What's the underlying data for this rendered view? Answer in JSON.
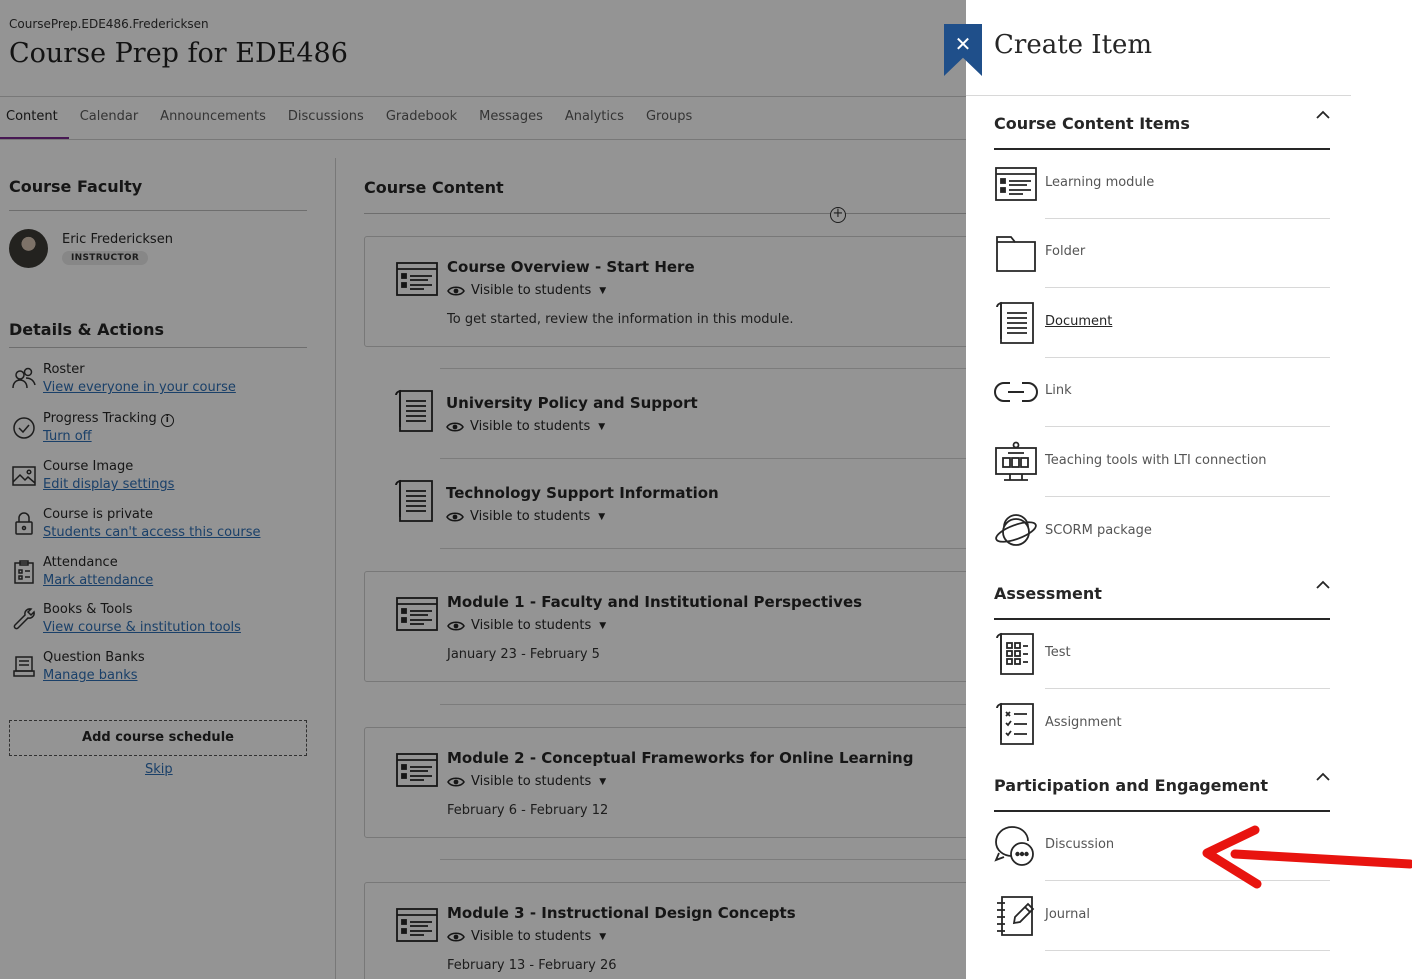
{
  "course": {
    "id": "CoursePrep.EDE486.Fredericksen",
    "title": "Course Prep for EDE486",
    "tabs": [
      "Content",
      "Calendar",
      "Announcements",
      "Discussions",
      "Gradebook",
      "Messages",
      "Analytics",
      "Groups"
    ],
    "active_tab": "Content"
  },
  "faculty": {
    "heading": "Course Faculty",
    "name": "Eric Fredericksen",
    "role": "INSTRUCTOR"
  },
  "details": {
    "heading": "Details & Actions",
    "items": [
      {
        "title": "Roster",
        "link": "View everyone in your course",
        "icon": "roster-icon"
      },
      {
        "title": "Progress Tracking",
        "link": "Turn off",
        "icon": "progress-icon"
      },
      {
        "title": "Course Image",
        "link": "Edit display settings",
        "icon": "image-icon"
      },
      {
        "title": "Course is private",
        "link": "Students can't access this course",
        "icon": "lock-icon"
      },
      {
        "title": "Attendance",
        "link": "Mark attendance",
        "icon": "attendance-icon"
      },
      {
        "title": "Books & Tools",
        "link": "View course & institution tools",
        "icon": "wrench-icon"
      },
      {
        "title": "Question Banks",
        "link": "Manage banks",
        "icon": "question-bank-icon"
      }
    ],
    "schedule_button": "Add course schedule",
    "skip_link": "Skip"
  },
  "content": {
    "heading": "Course Content",
    "visibility_label": "Visible to students",
    "items": [
      {
        "title": "Course Overview - Start Here",
        "desc": "To get started, review the information in this module.",
        "type": "module"
      },
      {
        "title": "University Policy and Support",
        "desc": "",
        "type": "document"
      },
      {
        "title": "Technology Support Information",
        "desc": "",
        "type": "document"
      },
      {
        "title": "Module 1 - Faculty and Institutional Perspectives",
        "desc": "January 23 - February 5",
        "type": "module"
      },
      {
        "title": "Module 2 - Conceptual Frameworks for Online Learning",
        "desc": "February 6 - February 12",
        "type": "module"
      },
      {
        "title": "Module 3 - Instructional Design Concepts",
        "desc": "February 13 - February 26",
        "type": "module"
      }
    ]
  },
  "panel": {
    "title": "Create Item",
    "close_icon": "close-icon",
    "groups": [
      {
        "heading": "Course Content Items",
        "items": [
          {
            "label": "Learning module",
            "icon": "learning-module-icon"
          },
          {
            "label": "Folder",
            "icon": "folder-icon"
          },
          {
            "label": "Document",
            "icon": "document-icon"
          },
          {
            "label": "Link",
            "icon": "link-icon"
          },
          {
            "label": "Teaching tools with LTI connection",
            "icon": "lti-tools-icon"
          },
          {
            "label": "SCORM package",
            "icon": "scorm-icon"
          }
        ]
      },
      {
        "heading": "Assessment",
        "items": [
          {
            "label": "Test",
            "icon": "test-icon"
          },
          {
            "label": "Assignment",
            "icon": "assignment-icon"
          }
        ]
      },
      {
        "heading": "Participation and Engagement",
        "items": [
          {
            "label": "Discussion",
            "icon": "discussion-icon"
          },
          {
            "label": "Journal",
            "icon": "journal-icon"
          }
        ]
      }
    ]
  },
  "colors": {
    "accent_tab": "#7b2a8f",
    "link": "#2e6fb5",
    "close_button": "#1f4f8a",
    "annotation_arrow": "#e8140f"
  }
}
